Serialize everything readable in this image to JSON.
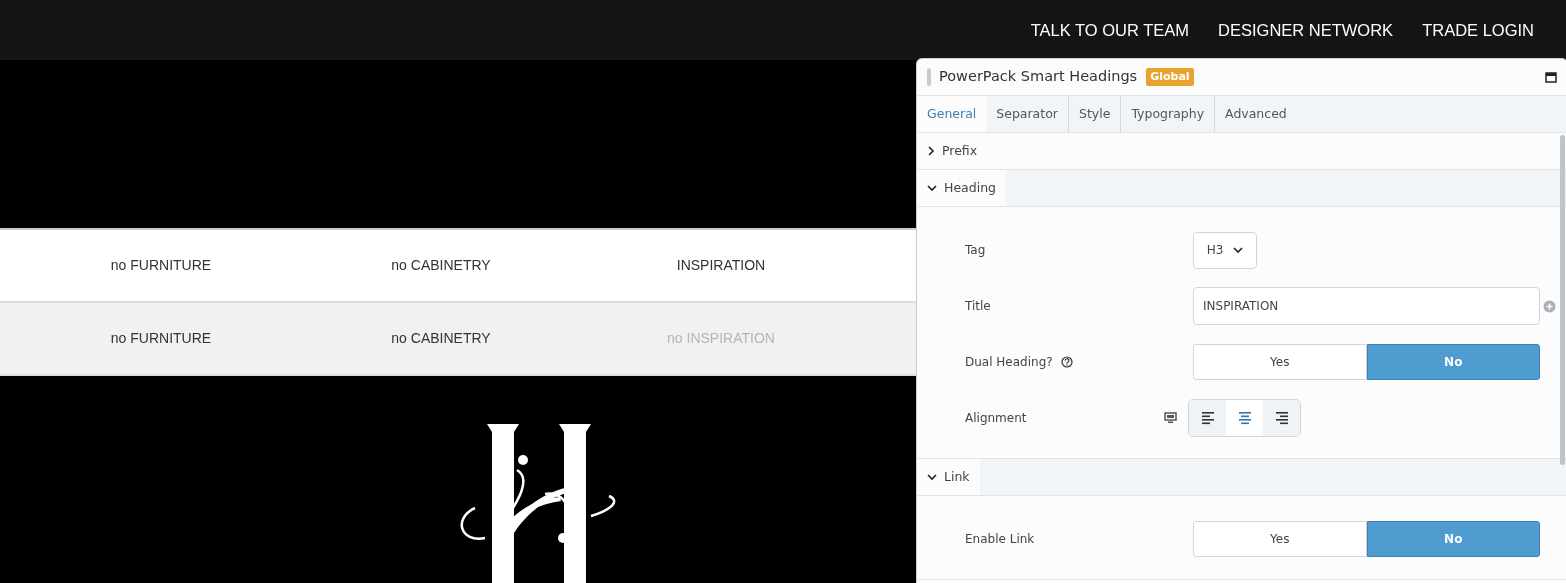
{
  "top_nav": {
    "links": [
      "TALK TO OUR TEAM",
      "DESIGNER NETWORK",
      "TRADE LOGIN"
    ]
  },
  "menu_rows": [
    {
      "shaded": false,
      "items": [
        {
          "label": "no FURNITURE",
          "disabled": false
        },
        {
          "label": "no CABINETRY",
          "disabled": false
        },
        {
          "label": "INSPIRATION",
          "disabled": false
        }
      ]
    },
    {
      "shaded": true,
      "items": [
        {
          "label": "no FURNITURE",
          "disabled": false
        },
        {
          "label": "no CABINETRY",
          "disabled": false
        },
        {
          "label": "no INSPIRATION",
          "disabled": true
        }
      ]
    }
  ],
  "panel": {
    "title": "PowerPack Smart Headings",
    "badge": "Global",
    "tabs": [
      {
        "label": "General",
        "selected": true
      },
      {
        "label": "Separator",
        "selected": false
      },
      {
        "label": "Style",
        "selected": false
      },
      {
        "label": "Typography",
        "selected": false
      },
      {
        "label": "Advanced",
        "selected": false
      }
    ],
    "sections": [
      {
        "title": "Prefix",
        "expanded": false
      },
      {
        "title": "Heading",
        "expanded": true,
        "fields": [
          {
            "kind": "select",
            "label": "Tag",
            "value": "H3"
          },
          {
            "kind": "text",
            "label": "Title",
            "value": "INSPIRATION"
          },
          {
            "kind": "toggle",
            "label": "Dual Heading?",
            "help": true,
            "options": [
              {
                "label": "Yes",
                "selected": false
              },
              {
                "label": "No",
                "selected": true
              }
            ]
          },
          {
            "kind": "align",
            "label": "Alignment",
            "responsive": true,
            "options": [
              {
                "kind": "left",
                "selected": false
              },
              {
                "kind": "center",
                "selected": true
              },
              {
                "kind": "right",
                "selected": false
              }
            ]
          }
        ]
      },
      {
        "title": "Link",
        "expanded": true,
        "fields": [
          {
            "kind": "toggle",
            "label": "Enable Link",
            "help": false,
            "options": [
              {
                "label": "Yes",
                "selected": false
              },
              {
                "label": "No",
                "selected": true
              }
            ]
          }
        ]
      }
    ]
  }
}
